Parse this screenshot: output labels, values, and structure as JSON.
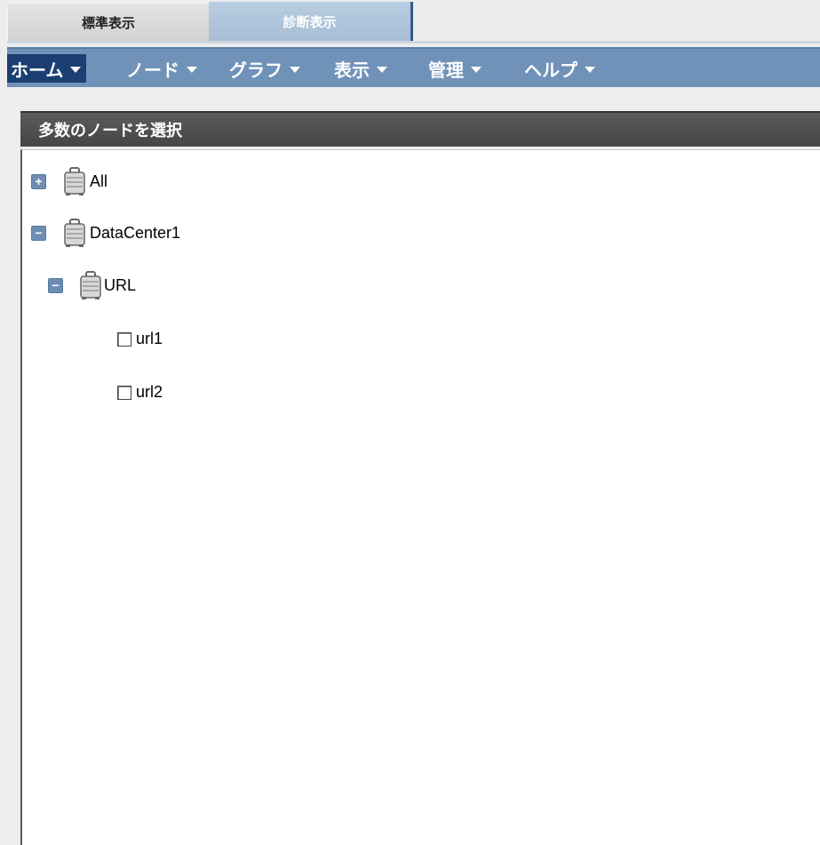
{
  "tabs": [
    {
      "label": "標準表示"
    },
    {
      "label": "診断表示"
    }
  ],
  "menu": [
    {
      "label": "ホーム"
    },
    {
      "label": "ノード"
    },
    {
      "label": "グラフ"
    },
    {
      "label": "表示"
    },
    {
      "label": "管理"
    },
    {
      "label": "ヘルプ"
    }
  ],
  "panel": {
    "title": "多数のノードを選択"
  },
  "tree": {
    "nodes": [
      {
        "label": "All",
        "expander": "+"
      },
      {
        "label": "DataCenter1",
        "expander": "−"
      },
      {
        "label": "URL",
        "expander": "−"
      }
    ],
    "leaves": [
      {
        "label": "url1"
      },
      {
        "label": "url2"
      }
    ]
  },
  "colors": {
    "menu_bg": "#7092b8",
    "menu_active": "#1c3f73",
    "panel_header": "#4f4f4f",
    "expander": "#6f8db3"
  },
  "icons": {
    "node": "briefcase-icon",
    "collapse": "collapse-icon",
    "expand": "expand-icon"
  }
}
